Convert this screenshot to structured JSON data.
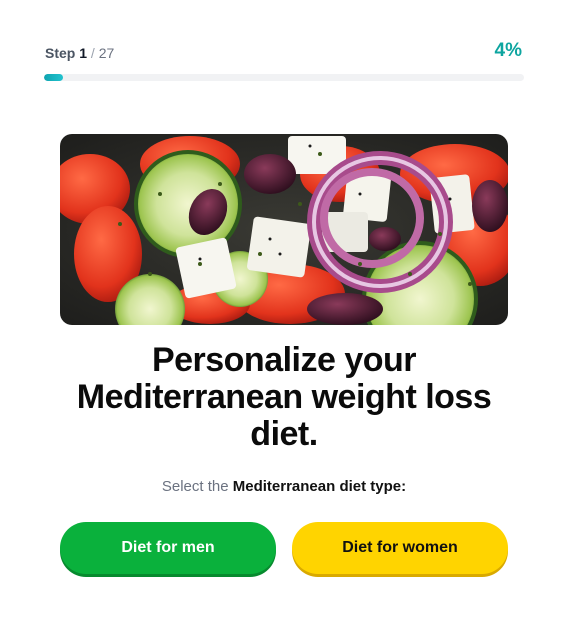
{
  "progress": {
    "step_word": "Step",
    "current": "1",
    "separator": "/",
    "total": "27",
    "percent_label": "4%",
    "percent_value": 4,
    "accent_color": "#0ea5a0"
  },
  "hero_image": {
    "subject": "Greek salad with tomatoes, cucumber, feta, olives and red onion"
  },
  "headline": "Personalize your Mediterranean weight loss diet.",
  "subline": {
    "prefix": "Select the",
    "emphasis": "Mediterranean diet type:"
  },
  "buttons": {
    "men": {
      "label": "Diet for men",
      "color": "#0ab13c"
    },
    "women": {
      "label": "Diet for women",
      "color": "#ffd400"
    }
  }
}
